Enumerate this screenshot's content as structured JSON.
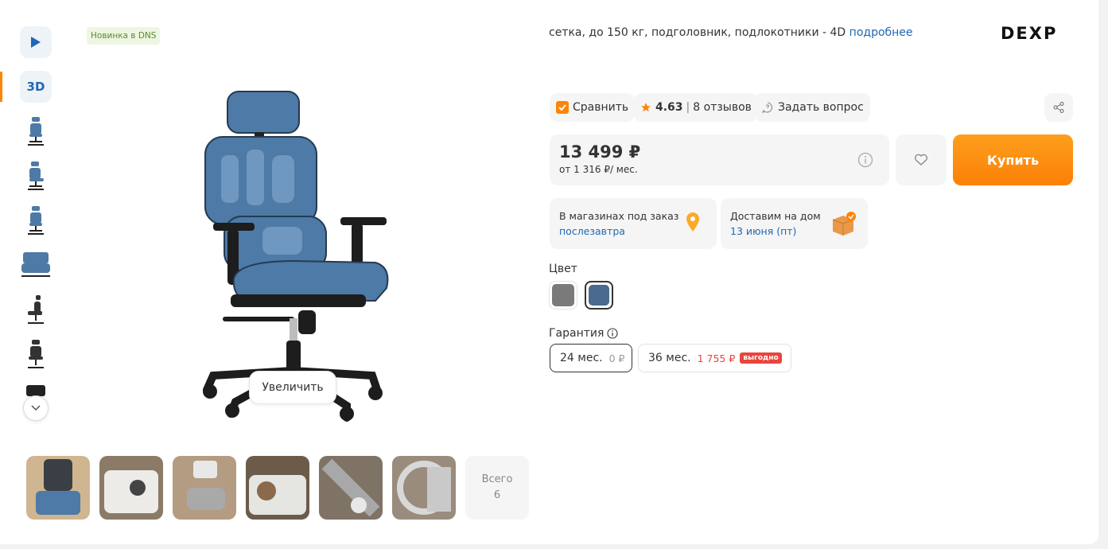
{
  "gallery": {
    "badge_new": "Новинка в DNS",
    "btn_3d": "3D",
    "zoom_label": "Увеличить",
    "total_label": "Всего",
    "total_count": "6"
  },
  "product": {
    "subtitle": "сетка, до 150 кг, подголовник, подлокотники - 4D",
    "more_link": "подробнее",
    "brand": "DEXP"
  },
  "actions": {
    "compare": "Сравнить",
    "rating": "4.63",
    "separator": "|",
    "reviews": "8 отзывов",
    "ask": "Задать вопрос"
  },
  "price": {
    "value": "13 499 ₽",
    "credit": "от 1 316 ₽/ мес.",
    "buy": "Купить"
  },
  "delivery": [
    {
      "title": "В магазинах под заказ",
      "value": "послезавтра"
    },
    {
      "title": "Доставим на дом",
      "value": "13 июня (пт)"
    }
  ],
  "color": {
    "label": "Цвет",
    "options": [
      {
        "hex": "#7a7a7a"
      },
      {
        "hex": "#4a6a8f"
      }
    ]
  },
  "warranty": {
    "label": "Гарантия",
    "options": [
      {
        "term": "24 мес.",
        "price": "0 ₽"
      },
      {
        "term": "36 мес.",
        "price": "1 755 ₽",
        "tag": "выгодно"
      }
    ]
  },
  "colors": {
    "accent": "#fc8507",
    "link": "#1e68b3",
    "chair": "#4d7aa6"
  }
}
